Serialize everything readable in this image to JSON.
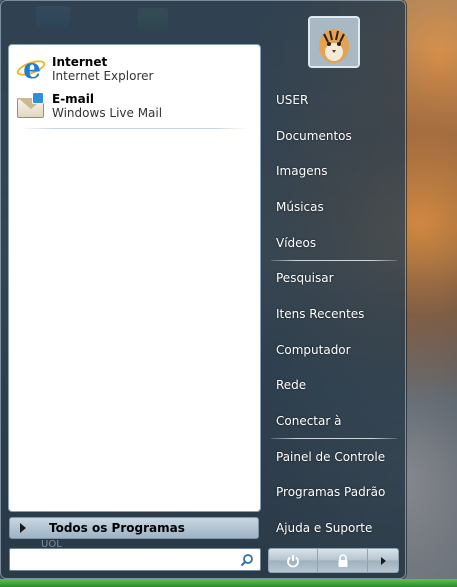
{
  "pinned": [
    {
      "title": "Internet",
      "subtitle": "Internet Explorer",
      "icon": "internet-explorer-icon"
    },
    {
      "title": "E-mail",
      "subtitle": "Windows Live Mail",
      "icon": "mail-icon"
    }
  ],
  "all_programs": {
    "label": "Todos os Programas",
    "icon": "triangle-right-icon"
  },
  "search": {
    "value": "",
    "placeholder": "",
    "icon": "search-icon"
  },
  "desktop_label": "UOL",
  "user_picture": {
    "icon": "tiger-avatar-icon"
  },
  "right_menu": {
    "user": "USER",
    "documents": "Documentos",
    "pictures": "Imagens",
    "music": "Músicas",
    "videos": "Vídeos",
    "search": "Pesquisar",
    "recent": "Itens Recentes",
    "computer": "Computador",
    "network": "Rede",
    "connect": "Conectar à",
    "control_panel": "Painel de Controle",
    "default_programs": "Programas Padrão",
    "help": "Ajuda e Suporte"
  },
  "power": {
    "power_icon": "power-icon",
    "lock_icon": "lock-icon",
    "arrow_icon": "arrow-right-icon"
  },
  "colors": {
    "menu_background": "#2e4252",
    "left_pane": "#ffffff",
    "taskbar": "#3aa63a"
  }
}
